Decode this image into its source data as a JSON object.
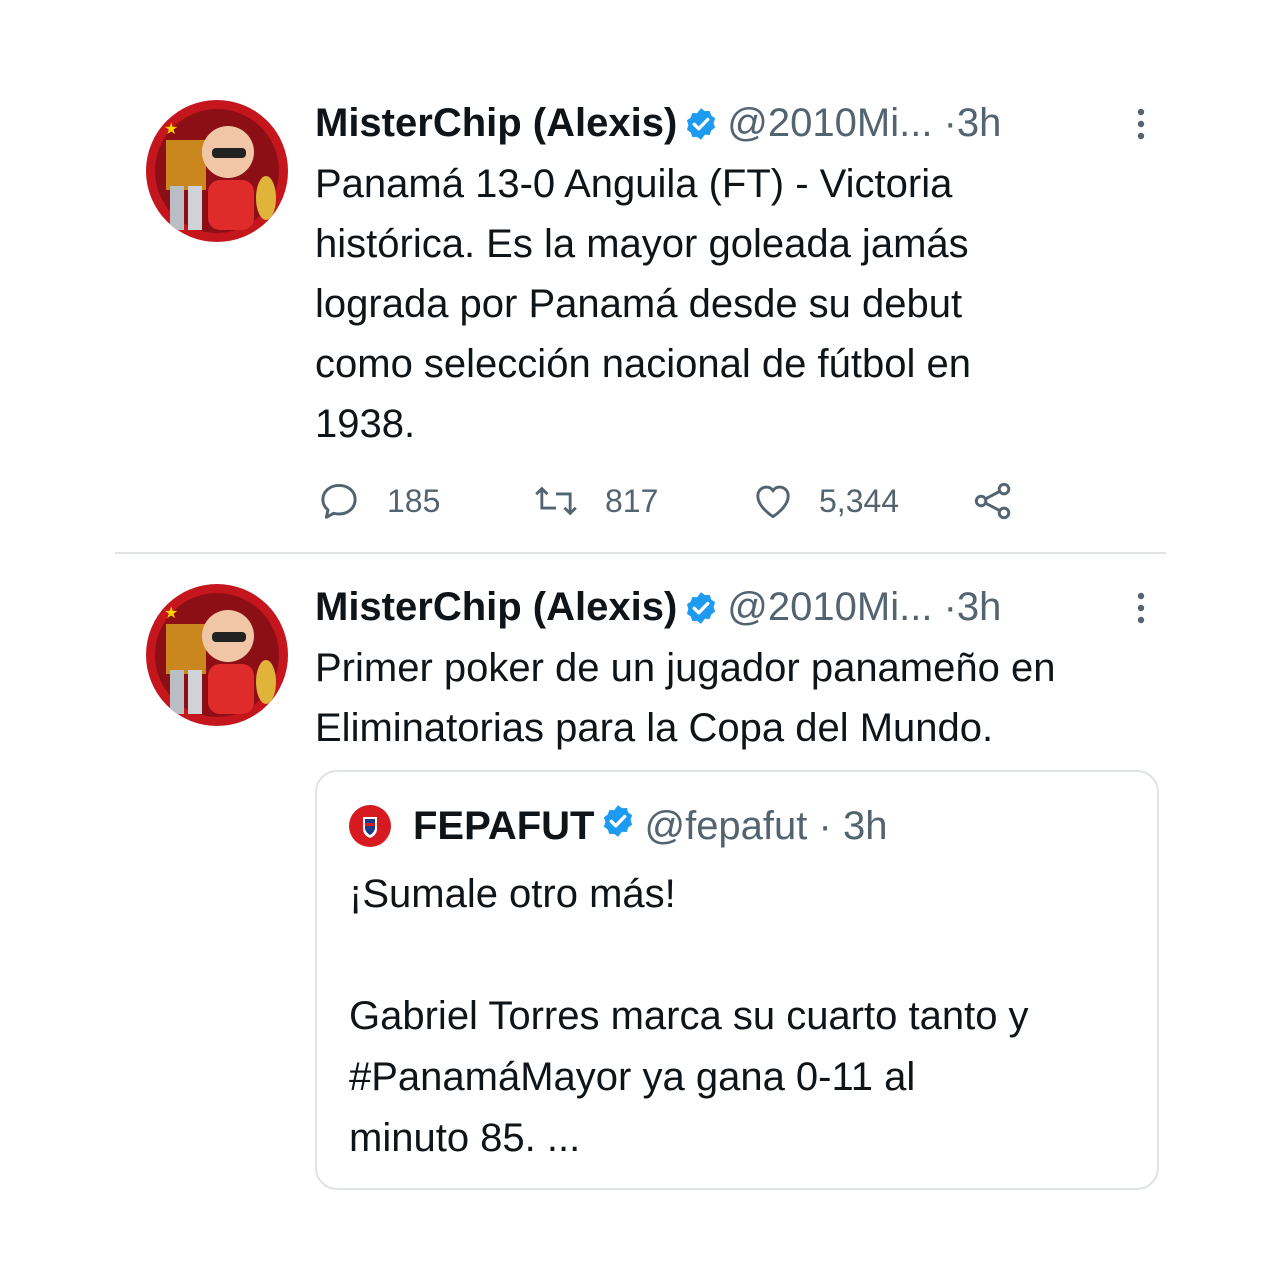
{
  "colors": {
    "text_primary": "#0f1419",
    "text_secondary": "#536471",
    "verified_blue": "#1d9bf0",
    "divider": "#e1e4e6",
    "avatar_red": "#c4161c"
  },
  "tweets": [
    {
      "display_name": "MisterChip (Alexis)",
      "handle": "@2010Mi...",
      "separator": "·",
      "time": "3h",
      "verified": true,
      "text": "Panamá 13-0 Anguila (FT) - Victoria\nhistórica. Es la mayor goleada jamás\nlograda por Panamá desde su debut\ncomo selección nacional de fútbol en\n1938.",
      "actions": {
        "reply_icon": "reply-icon",
        "reply_count": "185",
        "retweet_icon": "retweet-icon",
        "retweet_count": "817",
        "like_icon": "heart-icon",
        "like_count": "5,344",
        "share_icon": "share-icon"
      }
    },
    {
      "display_name": "MisterChip (Alexis)",
      "handle": "@2010Mi...",
      "separator": "·",
      "time": "3h",
      "verified": true,
      "text": "Primer poker de un jugador panameño en\nEliminatorias para la Copa del Mundo.",
      "quoted_tweet": {
        "display_name": "FEPAFUT",
        "handle": "@fepafut",
        "separator": "·",
        "time": "3h",
        "verified": true,
        "text": "¡Sumale otro más!\n\nGabriel Torres marca su cuarto tanto y\n#PanamáMayor ya gana 0-11 al\nminuto 85. ..."
      }
    }
  ]
}
